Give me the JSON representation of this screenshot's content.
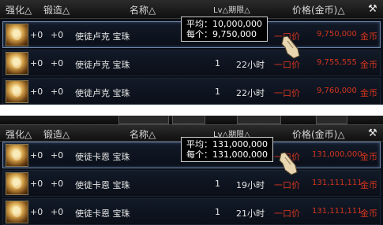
{
  "header": {
    "qianghua": "强化△",
    "duanzao": "锻造△",
    "name": "名称△",
    "lv": "Lv△期限△",
    "price": "价格(金币)△",
    "hammer_icon": "hammer-icon"
  },
  "bottom_strip_text": "",
  "top": {
    "tooltip": {
      "avg": "平均：10,000,000",
      "each": "每个：9,750,000"
    },
    "rows": [
      {
        "qianghua": "+0",
        "duanzao": "+0",
        "name": "使徒卢克 宝珠",
        "lv": "",
        "time": "",
        "yikou": "一口价",
        "price": "9,750,000",
        "unit": "金币"
      },
      {
        "qianghua": "+0",
        "duanzao": "+0",
        "name": "使徒卢克 宝珠",
        "lv": "1",
        "time": "22小时",
        "yikou": "一口价",
        "price": "9,755,555",
        "unit": "金币"
      },
      {
        "qianghua": "+0",
        "duanzao": "+0",
        "name": "使徒卢克 宝珠",
        "lv": "1",
        "time": "22小时",
        "yikou": "一口价",
        "price": "9,760,000",
        "unit": "金币"
      }
    ]
  },
  "bottom": {
    "tooltip": {
      "avg": "平均：131,000,000",
      "each": "每个：131,000,000"
    },
    "rows": [
      {
        "qianghua": "+0",
        "duanzao": "+0",
        "name": "使徒卡恩 宝珠",
        "lv": "",
        "time": "",
        "yikou": "一口价",
        "price": "131,000,000",
        "unit": "金币"
      },
      {
        "qianghua": "+0",
        "duanzao": "+0",
        "name": "使徒卡恩 宝珠",
        "lv": "1",
        "time": "19小时",
        "yikou": "一口价",
        "price": "131,111,111",
        "unit": "金币"
      },
      {
        "qianghua": "+0",
        "duanzao": "+0",
        "name": "使徒卡恩 宝珠",
        "lv": "1",
        "time": "21小时",
        "yikou": "一口价",
        "price": "131,111,111",
        "unit": "金币"
      }
    ]
  }
}
